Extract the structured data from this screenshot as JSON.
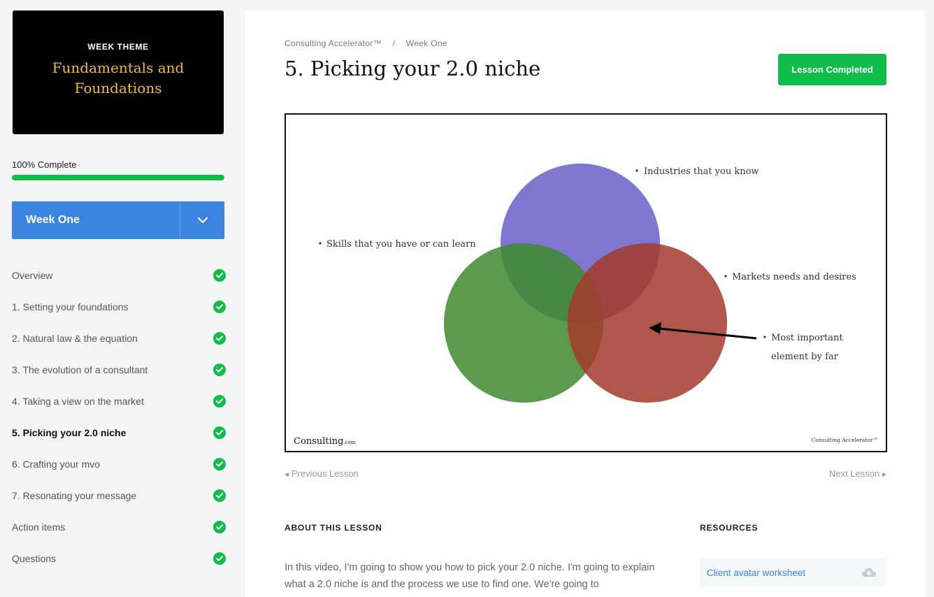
{
  "sidebar": {
    "theme_label": "WEEK THEME",
    "theme_title_line1": "Fundamentals and",
    "theme_title_line2": "Foundations",
    "progress_text": "100% Complete",
    "progress_fraction": 1.0,
    "week_label": "Week One",
    "lessons": [
      {
        "label": "Overview",
        "completed": true
      },
      {
        "label": "1. Setting your foundations",
        "completed": true
      },
      {
        "label": "2. Natural law & the equation",
        "completed": true
      },
      {
        "label": "3. The evolution of a consultant",
        "completed": true
      },
      {
        "label": "4. Taking a view on the market",
        "completed": true
      },
      {
        "label": "5. Picking your 2.0 niche",
        "completed": true,
        "active": true
      },
      {
        "label": "6. Crafting your mvo",
        "completed": true
      },
      {
        "label": "7. Resonating your message",
        "completed": true
      },
      {
        "label": "Action items",
        "completed": true
      },
      {
        "label": "Questions",
        "completed": true
      }
    ]
  },
  "main": {
    "breadcrumb_course": "Consulting Accelerator™",
    "breadcrumb_sep": "/",
    "breadcrumb_week": "Week One",
    "title": "5. Picking your 2.0 niche",
    "complete_button": "Lesson Completed",
    "slide": {
      "label_industries": "Industries that you know",
      "label_skills": "Skills that you have or can learn",
      "label_markets": "Markets needs and desires",
      "label_important_1": "Most important",
      "label_important_2": "element by far",
      "logo_text": "Consulting",
      "logo_suffix": ".com",
      "footer_right": "Consulting Accelerator™",
      "colors": {
        "industries": "#6a5fc9",
        "skills": "#3f8a2f",
        "markets": "#a53a2c"
      }
    },
    "prev_lesson": "Previous Lesson",
    "next_lesson": "Next Lesson",
    "about_heading": "ABOUT THIS LESSON",
    "about_text": "In this video, I'm going to show you how to pick your 2.0 niche. I'm going to explain what a 2.0 niche is and the process we use to find one. We're going to",
    "resources_heading": "RESOURCES",
    "resources": [
      {
        "label": "Client avatar worksheet",
        "icon": "cloud-download-icon"
      }
    ]
  },
  "colors": {
    "accent_green": "#11bd4a",
    "accent_blue": "#3b84e0"
  }
}
